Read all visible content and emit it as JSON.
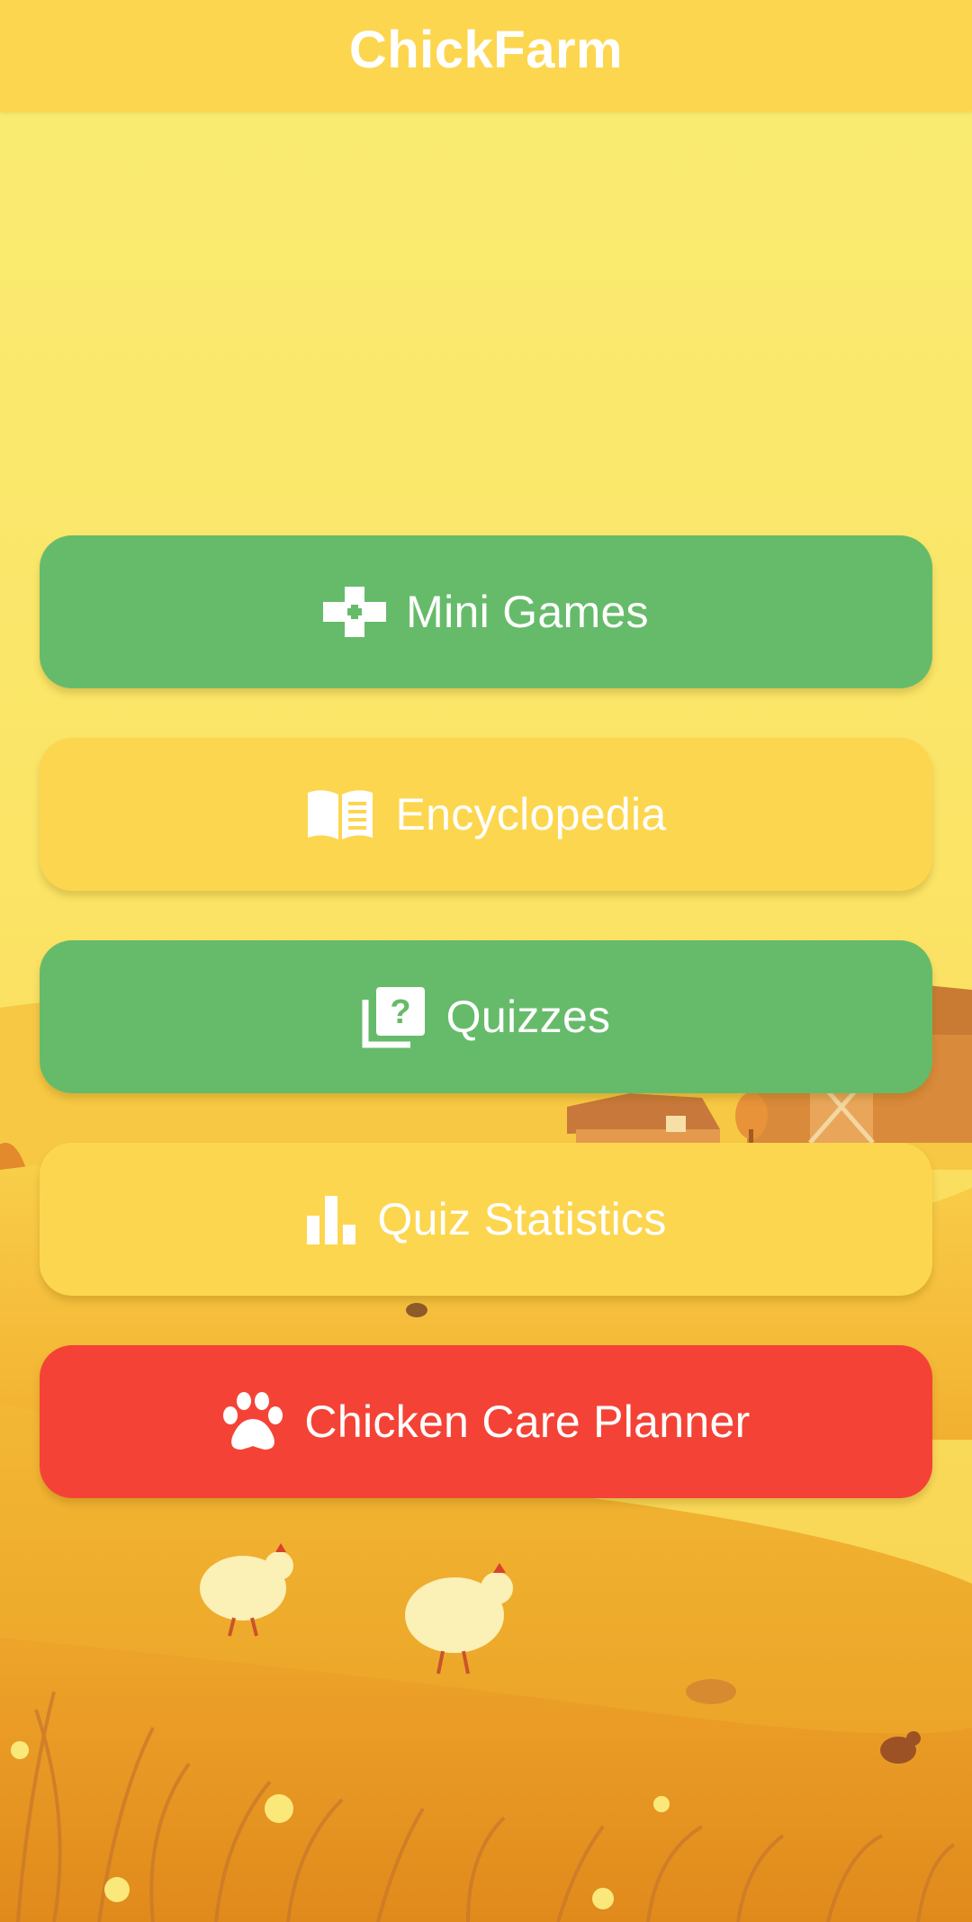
{
  "app_bar": {
    "title": "ChickFarm",
    "color": "#fdd64f"
  },
  "menu": {
    "items": [
      {
        "label": "Mini Games",
        "icon": "gamepad-icon",
        "color": "#66bb6a"
      },
      {
        "label": "Encyclopedia",
        "icon": "book-icon",
        "color": "#fdd64f"
      },
      {
        "label": "Quizzes",
        "icon": "quiz-icon",
        "color": "#66bb6a"
      },
      {
        "label": "Quiz Statistics",
        "icon": "bar-chart-icon",
        "color": "#fdd64f"
      },
      {
        "label": "Chicken Care Planner",
        "icon": "paw-icon",
        "color": "#f44336"
      }
    ]
  },
  "background": {
    "scene": "farm-landscape-illustration"
  }
}
